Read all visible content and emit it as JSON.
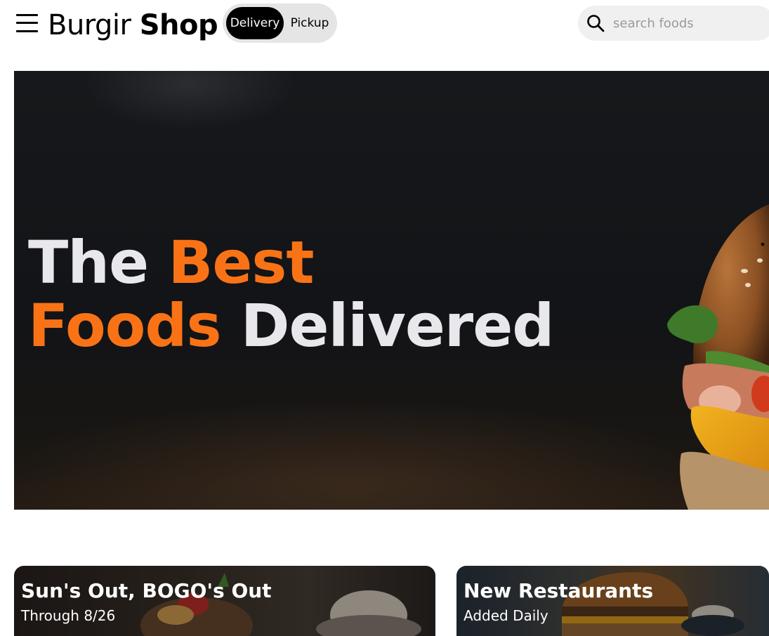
{
  "header": {
    "menu_icon": "hamburger-menu-icon",
    "brand_light": "Burgir",
    "brand_bold": "Shop",
    "toggle": {
      "delivery_label": "Delivery",
      "pickup_label": "Pickup",
      "selected": "Delivery"
    },
    "search": {
      "icon": "search-icon",
      "placeholder": "search foods",
      "value": ""
    }
  },
  "hero": {
    "line1_white": "The",
    "line1_accent": "Best",
    "line2_accent": "Foods",
    "line2_white": "Delivered",
    "accent_color": "#f97316",
    "text_color": "#e8e8ec"
  },
  "promos": [
    {
      "title": "Sun's Out, BOGO's Out",
      "subtitle": "Through 8/26"
    },
    {
      "title": "New Restaurants",
      "subtitle": "Added Daily"
    }
  ]
}
